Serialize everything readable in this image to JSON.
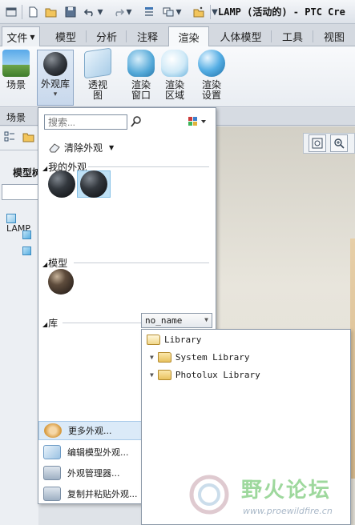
{
  "window": {
    "title": "LAMP (活动的) - PTC Cre"
  },
  "ribbon_tabs": [
    {
      "label": "文件",
      "dropdown": true
    },
    {
      "label": "模型"
    },
    {
      "label": "分析"
    },
    {
      "label": "注释"
    },
    {
      "label": "渲染",
      "active": true
    },
    {
      "label": "人体模型"
    },
    {
      "label": "工具"
    },
    {
      "label": "视图"
    }
  ],
  "ribbon": {
    "scene": "场景",
    "appearance_gallery": "外观库",
    "perspective_line1": "透视",
    "perspective_line2": "图",
    "render_window_line1": "渲染",
    "render_window_line2": "窗口",
    "render_region_line1": "渲染",
    "render_region_line2": "区域",
    "render_settings_line1": "渲染",
    "render_settings_line2": "设置",
    "group_label": "场景"
  },
  "model_tree": {
    "title": "模型树",
    "root": "LAMP"
  },
  "gallery": {
    "search_placeholder": "搜索...",
    "clear_label": "清除外观",
    "my_appearances": "我的外观",
    "model_section": "模型",
    "library_section": "库",
    "library_select_value": "no_name",
    "menu": [
      {
        "label": "更多外观...",
        "icon": "more-appearances-icon",
        "highlighted": true
      },
      {
        "label": "编辑模型外观...",
        "icon": "edit-appearance-icon"
      },
      {
        "label": "外观管理器...",
        "icon": "appearance-manager-icon"
      },
      {
        "label": "复制并粘贴外观...",
        "icon": "copy-paste-appearance-icon"
      }
    ]
  },
  "library_dropdown": {
    "items": [
      {
        "label": "Library"
      },
      {
        "label": "System Library"
      },
      {
        "label": "Photolux Library"
      }
    ]
  },
  "watermark": {
    "text": "野火论坛",
    "url": "www.proewildfire.cn"
  }
}
